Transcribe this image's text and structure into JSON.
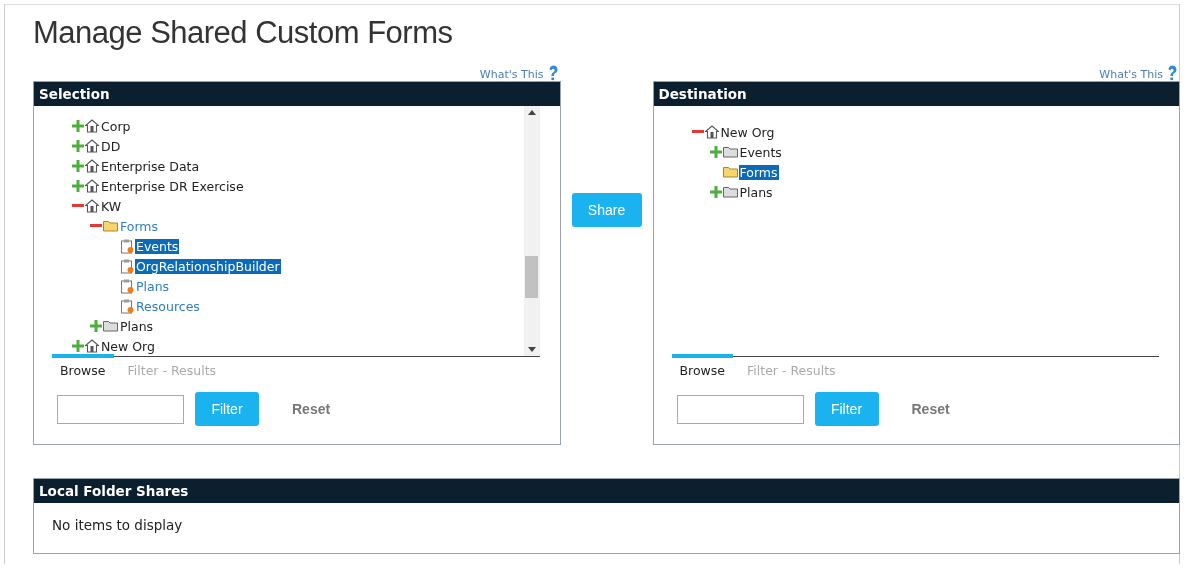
{
  "page": {
    "title": "Manage Shared Custom Forms"
  },
  "selection": {
    "help_link": "What's This",
    "header": "Selection",
    "tree": [
      {
        "label": "Corp",
        "kind": "org",
        "expanded": false,
        "selected": false,
        "link": false
      },
      {
        "label": "DD",
        "kind": "org",
        "expanded": false,
        "selected": false,
        "link": false
      },
      {
        "label": "Enterprise Data",
        "kind": "org",
        "expanded": false,
        "selected": false,
        "link": false
      },
      {
        "label": "Enterprise DR Exercise",
        "kind": "org",
        "expanded": false,
        "selected": false,
        "link": false
      },
      {
        "label": "KW",
        "kind": "org",
        "expanded": true,
        "selected": false,
        "link": false,
        "children": [
          {
            "label": "Forms",
            "kind": "folder",
            "expanded": true,
            "selected": false,
            "link": true,
            "children": [
              {
                "label": "Events",
                "kind": "form",
                "selected": true,
                "link": true
              },
              {
                "label": "OrgRelationshipBuilder",
                "kind": "form",
                "selected": true,
                "link": true
              },
              {
                "label": "Plans",
                "kind": "form",
                "selected": false,
                "link": true
              },
              {
                "label": "Resources",
                "kind": "form",
                "selected": false,
                "link": true
              }
            ]
          },
          {
            "label": "Plans",
            "kind": "folder",
            "expanded": false,
            "selected": false,
            "link": false
          }
        ]
      },
      {
        "label": "New Org",
        "kind": "org",
        "expanded": false,
        "selected": false,
        "link": false
      }
    ],
    "tabs": [
      {
        "label": "Browse",
        "selected": true
      },
      {
        "label": "Filter - Results",
        "selected": false
      }
    ],
    "filter_button": "Filter",
    "reset_button": "Reset"
  },
  "share_button": "Share",
  "destination": {
    "help_link": "What's This",
    "header": "Destination",
    "tree": [
      {
        "label": "New Org",
        "kind": "org",
        "expanded": true,
        "selected": false,
        "link": false,
        "children": [
          {
            "label": "Events",
            "kind": "folder",
            "expanded": false,
            "selected": false,
            "link": false
          },
          {
            "label": "Forms",
            "kind": "folder",
            "selected": true,
            "link": false
          },
          {
            "label": "Plans",
            "kind": "folder",
            "expanded": false,
            "selected": false,
            "link": false
          }
        ]
      }
    ],
    "tabs": [
      {
        "label": "Browse",
        "selected": true
      },
      {
        "label": "Filter - Results",
        "selected": false
      }
    ],
    "filter_button": "Filter",
    "reset_button": "Reset"
  },
  "local_folder_shares": {
    "header": "Local Folder Shares",
    "empty_message": "No items to display"
  }
}
